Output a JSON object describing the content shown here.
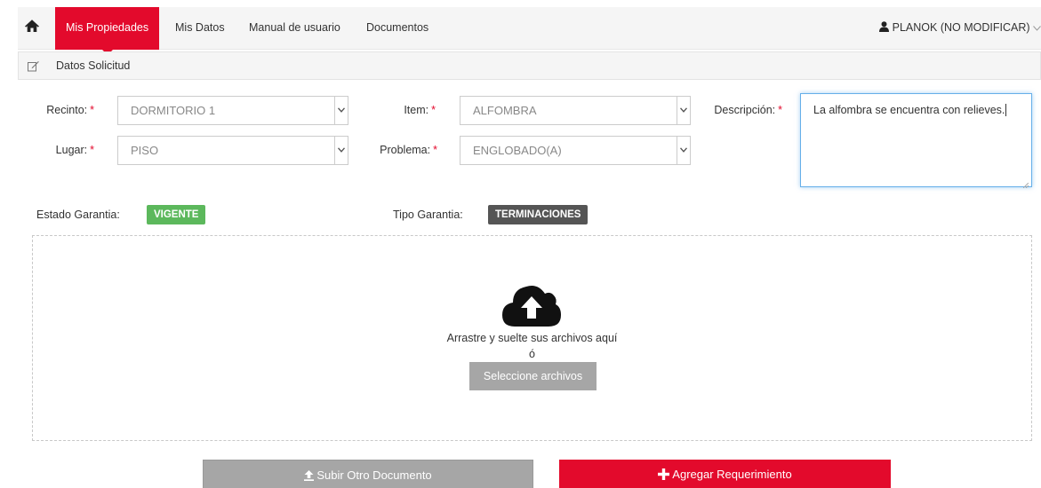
{
  "nav": {
    "items": [
      {
        "label": "Mis Propiedades",
        "active": true
      },
      {
        "label": "Mis Datos",
        "active": false
      },
      {
        "label": "Manual de usuario",
        "active": false
      },
      {
        "label": "Documentos",
        "active": false
      }
    ],
    "user": "PLANOK (NO MODIFICAR)",
    "accent_color": "#e30a2c"
  },
  "panel": {
    "title": "Datos Solicitud"
  },
  "form": {
    "recinto": {
      "label": "Recinto:",
      "value": "DORMITORIO 1"
    },
    "item": {
      "label": "Item:",
      "value": "ALFOMBRA"
    },
    "descripcion": {
      "label": "Descripción:",
      "value": "La alfombra se encuentra con relieves."
    },
    "lugar": {
      "label": "Lugar:",
      "value": "PISO"
    },
    "problema": {
      "label": "Problema:",
      "value": "ENGLOBADO(A)"
    },
    "required_mark": "*"
  },
  "garantia": {
    "estado_label": "Estado Garantia:",
    "estado_value": "VIGENTE",
    "estado_color": "#5cb85c",
    "tipo_label": "Tipo Garantia:",
    "tipo_value": "TERMINACIONES"
  },
  "dropzone": {
    "icon": "cloud-upload-icon",
    "text": "Arrastre y suelte sus archivos aquí",
    "or": "ó",
    "select_button": "Seleccione archivos"
  },
  "actions": {
    "upload_label": "Subir Otro Documento",
    "add_label": "Agregar Requerimiento"
  }
}
